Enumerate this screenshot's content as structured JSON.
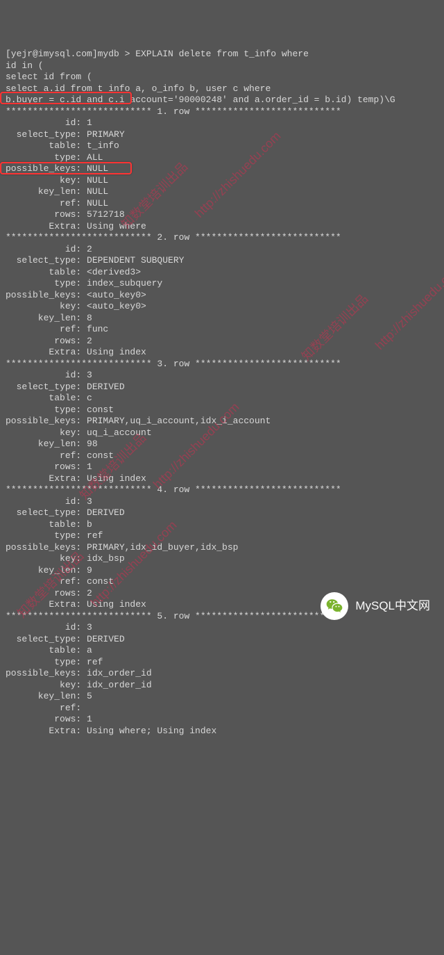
{
  "query": {
    "prompt": "[yejr@imysql.com]mydb > EXPLAIN delete from t_info where",
    "l2": "id in (",
    "l3": "select id from (",
    "l4": "select a.id from t_info a, o_info b, user c where",
    "l5": "b.buyer = c.id and c.i_account='90000248' and a.order_id = b.id) temp)\\G"
  },
  "rows": [
    {
      "header": "*************************** 1. row ***************************",
      "id": "1",
      "select_type": "PRIMARY",
      "table": "t_info",
      "type": "ALL",
      "possible_keys": "NULL",
      "key": "NULL",
      "key_len": "NULL",
      "ref": "NULL",
      "rows": "5712718",
      "Extra": "Using where"
    },
    {
      "header": "*************************** 2. row ***************************",
      "id": "2",
      "select_type": "DEPENDENT SUBQUERY",
      "table": "<derived3>",
      "type": "index_subquery",
      "possible_keys": "<auto_key0>",
      "key": "<auto_key0>",
      "key_len": "8",
      "ref": "func",
      "rows": "2",
      "Extra": "Using index"
    },
    {
      "header": "*************************** 3. row ***************************",
      "id": "3",
      "select_type": "DERIVED",
      "table": "c",
      "type": "const",
      "possible_keys": "PRIMARY,uq_i_account,idx_i_account",
      "key": "uq_i_account",
      "key_len": "98",
      "ref": "const",
      "rows": "1",
      "Extra": "Using index"
    },
    {
      "header": "*************************** 4. row ***************************",
      "id": "3",
      "select_type": "DERIVED",
      "table": "b",
      "type": "ref",
      "possible_keys": "PRIMARY,idx_id_buyer,idx_bsp",
      "key": "idx_bsp",
      "key_len": "9",
      "ref": "const",
      "rows": "2",
      "Extra": "Using index"
    },
    {
      "header": "*************************** 5. row ***************************",
      "id": "3",
      "select_type": "DERIVED",
      "table": "a",
      "type": "ref",
      "possible_keys": "idx_order_id",
      "key": "idx_order_id",
      "key_len": "5",
      "ref": "",
      "rows": "1",
      "Extra": "Using where; Using index"
    }
  ],
  "watermarks": {
    "w1": "知数堂培训出品",
    "w2": "http://zhishuedu.com",
    "w3": "知数堂培训出品",
    "w4": "http://zhishuedu.com",
    "w5": "知数堂培训出品",
    "w6": "http://zhishuedu.com",
    "w7": "知数堂培训出品",
    "w8": "http://zhishuedu.com"
  },
  "footer": {
    "text": "MySQL中文网"
  }
}
